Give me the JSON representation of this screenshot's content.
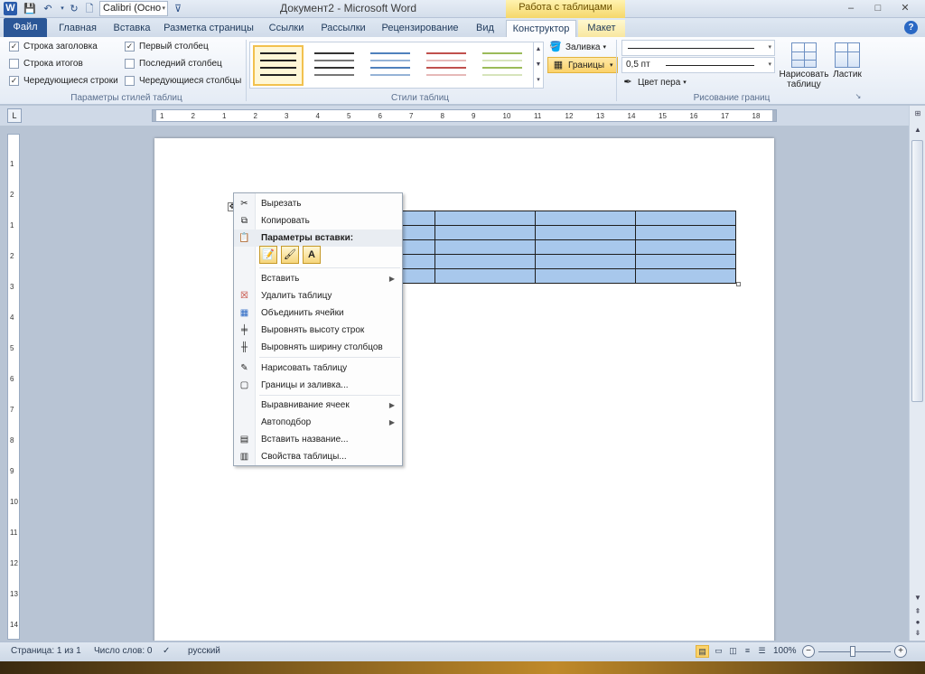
{
  "titlebar": {
    "app_logo": "W",
    "font_name": "Calibri (Осно",
    "doc_title": "Документ2  -  Microsoft Word",
    "context_title": "Работа с таблицами",
    "minimize": "–",
    "maximize": "□",
    "close": "✕"
  },
  "tabs": [
    {
      "label": "Файл"
    },
    {
      "label": "Главная"
    },
    {
      "label": "Вставка"
    },
    {
      "label": "Разметка страницы"
    },
    {
      "label": "Ссылки"
    },
    {
      "label": "Рассылки"
    },
    {
      "label": "Рецензирование"
    },
    {
      "label": "Вид"
    },
    {
      "label": "Конструктор"
    },
    {
      "label": "Макет"
    }
  ],
  "ribbon": {
    "options": {
      "header_row": {
        "label": "Строка заголовка",
        "checked": "✓"
      },
      "total_row": {
        "label": "Строка итогов",
        "checked": ""
      },
      "banded_rows": {
        "label": "Чередующиеся строки",
        "checked": "✓"
      },
      "first_column": {
        "label": "Первый столбец",
        "checked": "✓"
      },
      "last_column": {
        "label": "Последний столбец",
        "checked": ""
      },
      "banded_columns": {
        "label": "Чередующиеся столбцы",
        "checked": ""
      },
      "group_label": "Параметры стилей таблиц"
    },
    "styles_group_label": "Стили таблиц",
    "shading_label": "Заливка",
    "borders_label": "Границы",
    "line_weight": "0,5 пт",
    "pen_color_label": "Цвет пера",
    "draw_table_label_1": "Нарисовать",
    "draw_table_label_2": "таблицу",
    "eraser_label": "Ластик",
    "draw_group_label": "Рисование границ"
  },
  "ruler": {
    "h_ticks": [
      "1",
      "2",
      "1",
      "2",
      "3",
      "4",
      "5",
      "6",
      "7",
      "8",
      "9",
      "10",
      "11",
      "12",
      "13",
      "14",
      "15",
      "16",
      "17",
      "18"
    ],
    "v_ticks": [
      "1",
      "2",
      "1",
      "2",
      "3",
      "4",
      "5",
      "6",
      "7",
      "8",
      "9",
      "10",
      "11",
      "12",
      "13",
      "14"
    ]
  },
  "table": {
    "rows": 5,
    "cols": 5
  },
  "context_menu": {
    "cut": "Вырезать",
    "copy": "Копировать",
    "paste_options": "Параметры вставки:",
    "insert": "Вставить",
    "delete_table": "Удалить таблицу",
    "merge_cells": "Объединить ячейки",
    "distribute_rows": "Выровнять высоту строк",
    "distribute_columns": "Выровнять ширину столбцов",
    "draw_table": "Нарисовать таблицу",
    "borders_shading": "Границы и заливка...",
    "cell_alignment": "Выравнивание ячеек",
    "autofit": "Автоподбор",
    "insert_caption": "Вставить название...",
    "table_properties": "Свойства таблицы..."
  },
  "statusbar": {
    "page": "Страница: 1 из 1",
    "words": "Число слов: 0",
    "language": "русский",
    "zoom": "100%"
  },
  "colors": {
    "accent": "#2b5797",
    "table_fill": "#a8c8ec",
    "context_tab": "#f5d76a"
  }
}
